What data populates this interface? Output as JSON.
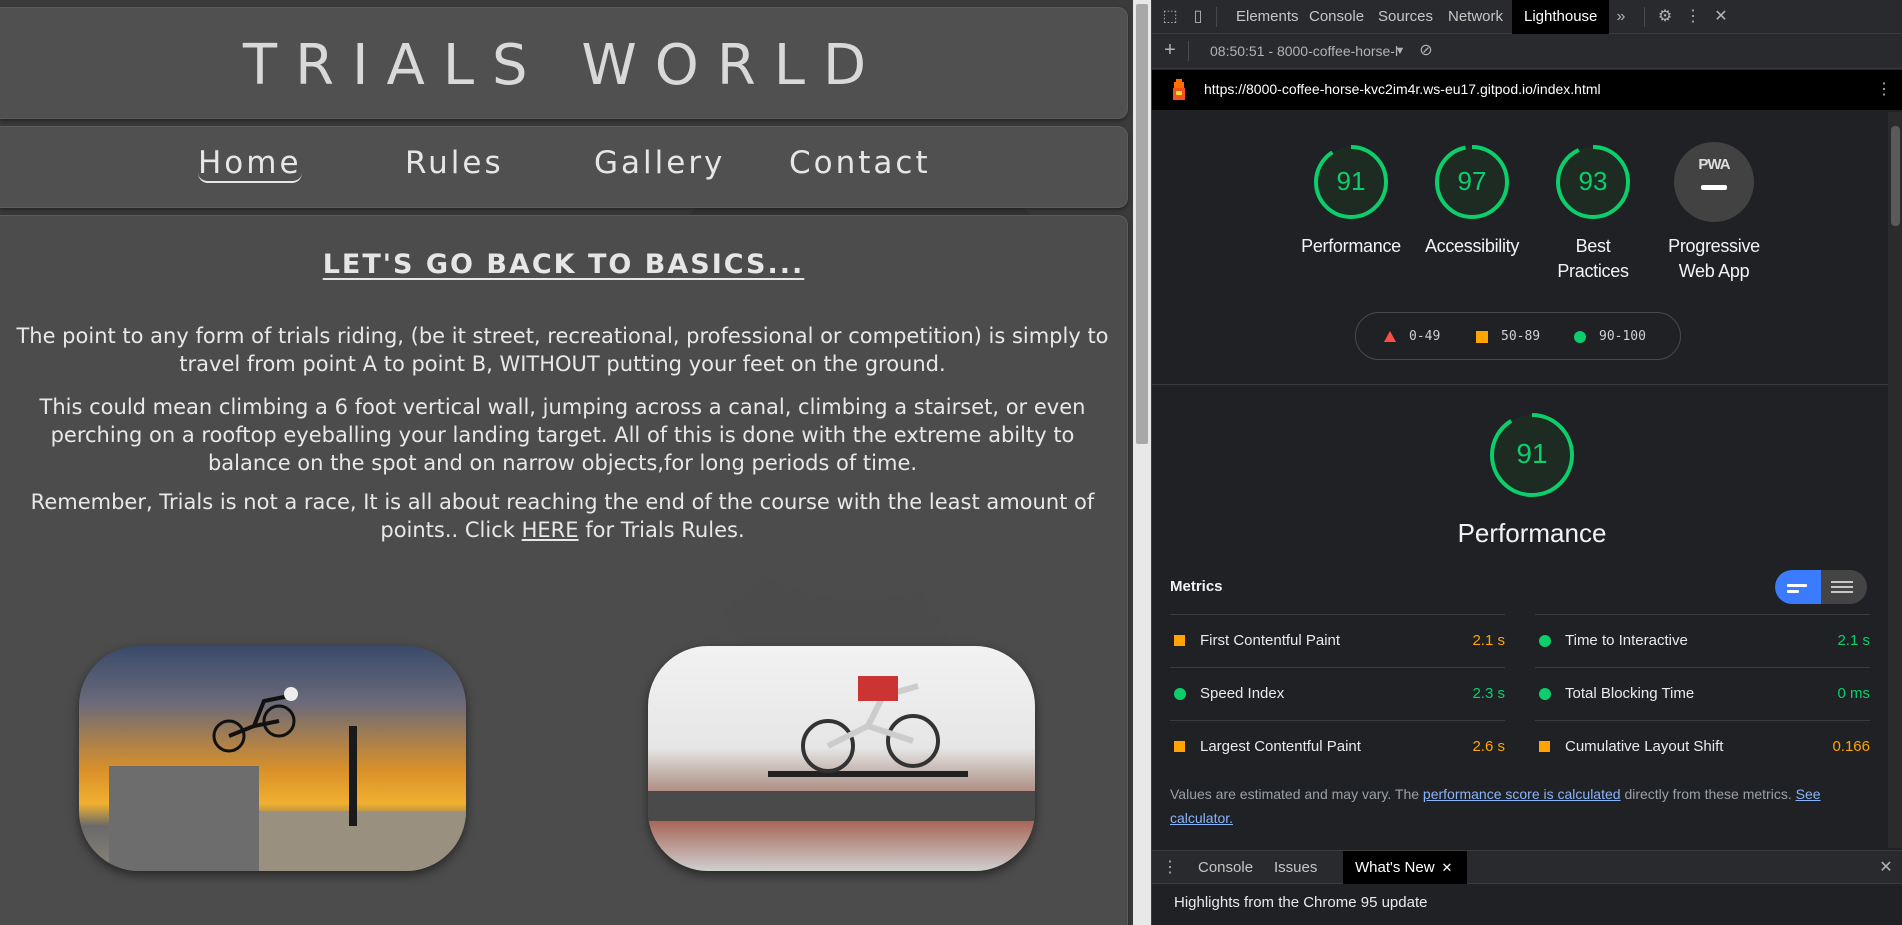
{
  "site": {
    "title": "TRIALS WORLD",
    "nav": [
      {
        "label": "Home",
        "active": true
      },
      {
        "label": "Rules",
        "active": false
      },
      {
        "label": "Gallery",
        "active": false
      },
      {
        "label": "Contact",
        "active": false
      }
    ],
    "heading": "LET'S GO BACK TO BASICS...",
    "paragraphs": {
      "p1": "The point to any form of trials riding, (be it street, recreational, professional or competition) is simply to travel from point A to point B, WITHOUT putting your feet on the ground.",
      "p2": "This could mean climbing a 6 foot vertical wall, jumping across a canal, climbing a stairset, or even perching on a rooftop eyeballing your landing target. All of this is done with the extreme abilty to balance on the spot and on narrow objects,for long periods of time.",
      "p3_before": "Remember, Trials is not a race, It is all about reaching the end of the course with the least amount of points.. Click ",
      "p3_link": "HERE",
      "p3_after": " for Trials Rules."
    }
  },
  "devtools": {
    "tabs": [
      "Elements",
      "Console",
      "Sources",
      "Network",
      "Lighthouse"
    ],
    "active_tab": "Lighthouse",
    "overflow_icon": "»",
    "toolbar_report": "08:50:51 - 8000-coffee-horse-l",
    "url": "https://8000-coffee-horse-kvc2im4r.ws-eu17.gitpod.io/index.html",
    "gauges": [
      {
        "score": "91",
        "label_1": "Performance",
        "label_2": ""
      },
      {
        "score": "97",
        "label_1": "Accessibility",
        "label_2": ""
      },
      {
        "score": "93",
        "label_1": "Best",
        "label_2": "Practices"
      }
    ],
    "pwa": {
      "badge": "PWA",
      "label_1": "Progressive",
      "label_2": "Web App"
    },
    "legend": {
      "fail": "0-49",
      "average": "50-89",
      "pass": "90-100"
    },
    "performance": {
      "score": "91",
      "title": "Performance"
    },
    "metrics_title": "Metrics",
    "metrics": [
      {
        "name": "First Contentful Paint",
        "value": "2.1 s",
        "status": "avg"
      },
      {
        "name": "Time to Interactive",
        "value": "2.1 s",
        "status": "good"
      },
      {
        "name": "Speed Index",
        "value": "2.3 s",
        "status": "good"
      },
      {
        "name": "Total Blocking Time",
        "value": "0 ms",
        "status": "good"
      },
      {
        "name": "Largest Contentful Paint",
        "value": "2.6 s",
        "status": "avg"
      },
      {
        "name": "Cumulative Layout Shift",
        "value": "0.166",
        "status": "avg"
      }
    ],
    "note": {
      "before": "Values are estimated and may vary. The ",
      "link1": "performance score is calculated",
      "middle": " directly from these metrics. ",
      "link2": "See calculator."
    },
    "drawer_tabs": [
      "Console",
      "Issues",
      "What's New"
    ],
    "drawer_active": "What's New",
    "drawer_text": "Highlights from the Chrome 95 update"
  },
  "colors": {
    "pass": "#0cce6b",
    "average": "#ffa400",
    "fail": "#ff4e42",
    "accent": "#3a7bff"
  }
}
